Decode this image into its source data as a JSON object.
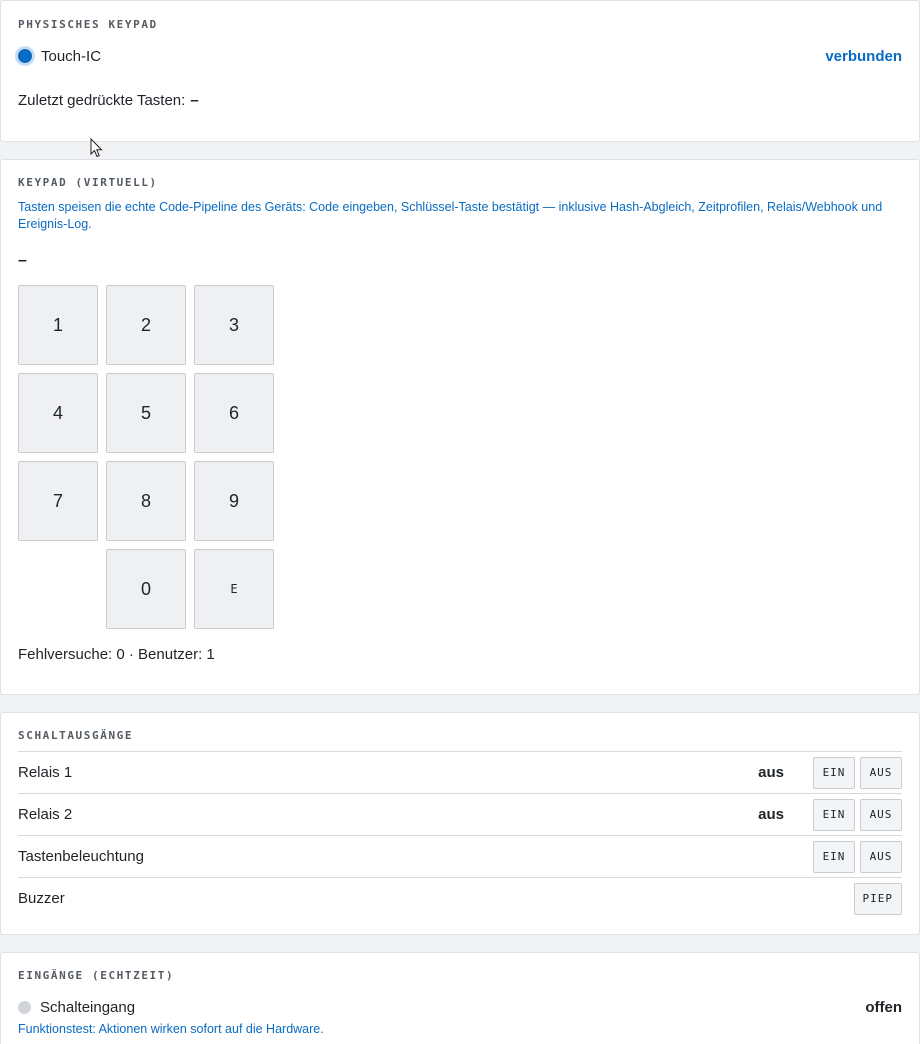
{
  "physical": {
    "title": "PHYSISCHES KEYPAD",
    "device_label": "Touch-IC",
    "status": "verbunden",
    "last_keys_label": "Zuletzt gedrückte Tasten:",
    "last_keys_value": "–"
  },
  "virtual": {
    "title": "KEYPAD (VIRTUELL)",
    "info": "Tasten speisen die echte Code-Pipeline des Geräts: Code eingeben, Schlüssel-Taste bestätigt — inklusive Hash-Abgleich, Zeitprofilen, Relais/Webhook und Ereignis-Log.",
    "display": "–",
    "keys": [
      "1",
      "2",
      "3",
      "4",
      "5",
      "6",
      "7",
      "8",
      "9",
      "0",
      "E"
    ],
    "stats": "Fehlversuche: 0 · Benutzer: 1"
  },
  "outputs": {
    "title": "SCHALTAUSGÄNGE",
    "rows": [
      {
        "name": "Relais 1",
        "state": "aus",
        "on": "EIN",
        "off": "AUS"
      },
      {
        "name": "Relais 2",
        "state": "aus",
        "on": "EIN",
        "off": "AUS"
      },
      {
        "name": "Tastenbeleuchtung",
        "on": "EIN",
        "off": "AUS"
      },
      {
        "name": "Buzzer",
        "beep": "PIEP"
      }
    ]
  },
  "inputs": {
    "title": "EINGÄNGE (ECHTZEIT)",
    "switch_label": "Schalteingang",
    "switch_state": "offen",
    "note": "Funktionstest: Aktionen wirken sofort auf die Hardware."
  },
  "colors": {
    "accent": "#0a6bc2",
    "connected_ring": "#c9def3",
    "idle_dot": "#d1d4d9"
  },
  "icons": [
    "status-dot-icon",
    "mouse-pointer-icon"
  ]
}
